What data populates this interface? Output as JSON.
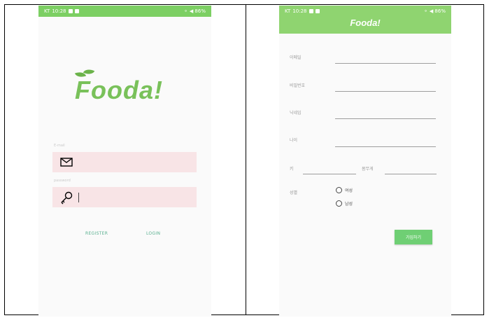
{
  "left_screen": {
    "status": {
      "carrier": "KT",
      "time": "10:28",
      "right": "⚬ ◀ 86%"
    },
    "logo_text": "Fooda!",
    "email_label": "E-mail",
    "password_label": "password",
    "buttons": {
      "register": "REGISTER",
      "login": "LOGIN"
    },
    "colors": {
      "brand": "#79c15a",
      "status": "#7ccf63",
      "field_bg": "#f8e4e6",
      "link": "#5ab090"
    }
  },
  "right_screen": {
    "status": {
      "carrier": "KT",
      "time": "10:28",
      "right": "⚬ ◀ 86%"
    },
    "title": "Fooda!",
    "labels": {
      "email": "이메일",
      "password": "비밀번호",
      "nickname": "닉네임",
      "age": "나이",
      "height": "키",
      "weight": "몸무게",
      "gender": "성별"
    },
    "gender_options": [
      "여성",
      "남성"
    ],
    "submit_label": "가입하기",
    "colors": {
      "appbar": "#8fd470",
      "button": "#6fcf74"
    }
  }
}
